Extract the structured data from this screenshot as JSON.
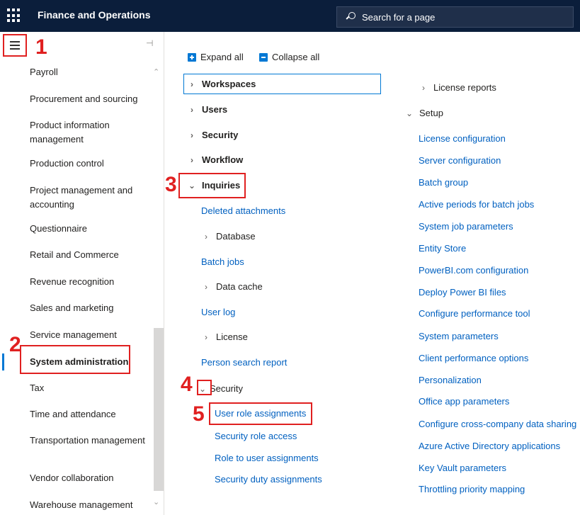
{
  "header": {
    "app_title": "Finance and Operations",
    "search_placeholder": "Search for a page"
  },
  "nav": {
    "items": [
      {
        "label": "Payroll"
      },
      {
        "label": "Procurement and sourcing"
      },
      {
        "label": "Product information management"
      },
      {
        "label": "Production control"
      },
      {
        "label": "Project management and accounting"
      },
      {
        "label": "Questionnaire"
      },
      {
        "label": "Retail and Commerce"
      },
      {
        "label": "Revenue recognition"
      },
      {
        "label": "Sales and marketing"
      },
      {
        "label": "Service management"
      },
      {
        "label": "System administration"
      },
      {
        "label": "Tax"
      },
      {
        "label": "Time and attendance"
      },
      {
        "label": "Transportation management"
      },
      {
        "label": "Vendor collaboration"
      },
      {
        "label": "Warehouse management"
      }
    ],
    "selected": "System administration"
  },
  "toolbar": {
    "expand_all": "Expand all",
    "collapse_all": "Collapse all"
  },
  "col1": {
    "workspaces": "Workspaces",
    "users": "Users",
    "security": "Security",
    "workflow": "Workflow",
    "inquiries": "Inquiries",
    "deleted_attachments": "Deleted attachments",
    "database": "Database",
    "batch_jobs": "Batch jobs",
    "data_cache": "Data cache",
    "user_log": "User log",
    "license": "License",
    "person_search_report": "Person search report",
    "security_sub": "Security",
    "user_role_assignments": "User role assignments",
    "security_role_access": "Security role access",
    "role_to_user_assignments": "Role to user assignments",
    "security_duty_assignments": "Security duty assignments"
  },
  "col2": {
    "license_reports": "License reports",
    "setup": "Setup",
    "links": [
      "License configuration",
      "Server configuration",
      "Batch group",
      "Active periods for batch jobs",
      "System job parameters",
      "Entity Store",
      "PowerBI.com configuration",
      "Deploy Power BI files",
      "Configure performance tool",
      "System parameters",
      "Client performance options",
      "Personalization",
      "Office app parameters",
      "Configure cross-company data sharing",
      "Azure Active Directory applications",
      "Key Vault parameters",
      "Throttling priority mapping"
    ]
  },
  "steps": [
    "1",
    "2",
    "3",
    "4",
    "5"
  ],
  "colors": {
    "topbar": "#0b1e3b",
    "link": "#0060c0",
    "highlight": "#e02020",
    "accent": "#0078d4"
  }
}
